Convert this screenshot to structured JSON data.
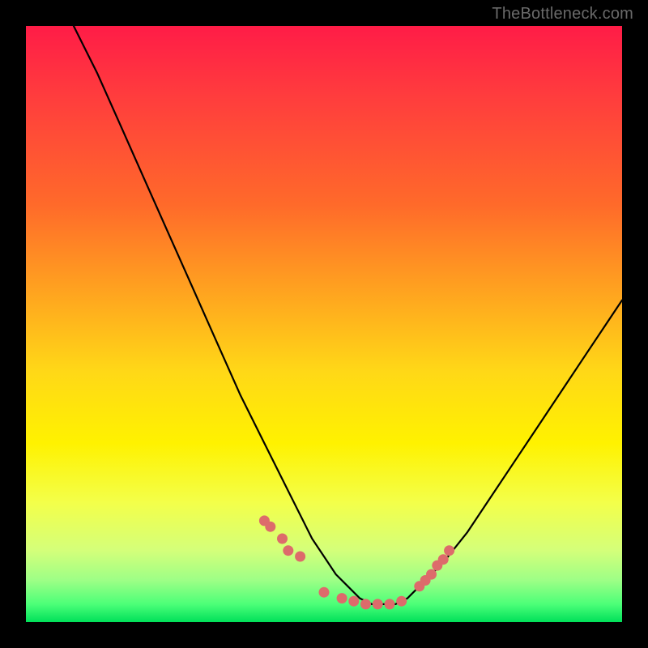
{
  "watermark": "TheBottleneck.com",
  "chart_data": {
    "type": "line",
    "title": "",
    "xlabel": "",
    "ylabel": "",
    "xlim": [
      0,
      100
    ],
    "ylim": [
      0,
      100
    ],
    "curve": {
      "name": "bottleneck-curve",
      "x": [
        8,
        12,
        16,
        20,
        24,
        28,
        32,
        36,
        40,
        44,
        48,
        50,
        52,
        54,
        56,
        58,
        60,
        62,
        64,
        66,
        70,
        74,
        78,
        82,
        86,
        90,
        94,
        98,
        100
      ],
      "y": [
        100,
        92,
        83,
        74,
        65,
        56,
        47,
        38,
        30,
        22,
        14,
        11,
        8,
        6,
        4,
        3,
        3,
        3,
        4,
        6,
        10,
        15,
        21,
        27,
        33,
        39,
        45,
        51,
        54
      ]
    },
    "markers": {
      "name": "highlight-dots",
      "color": "#dd6b6b",
      "x": [
        40,
        41,
        43,
        44,
        46,
        50,
        53,
        55,
        57,
        59,
        61,
        63,
        66,
        67,
        68,
        69,
        70,
        71
      ],
      "y": [
        17,
        16,
        14,
        12,
        11,
        5,
        4,
        3.5,
        3,
        3,
        3,
        3.5,
        6,
        7,
        8,
        9.5,
        10.5,
        12
      ]
    }
  }
}
